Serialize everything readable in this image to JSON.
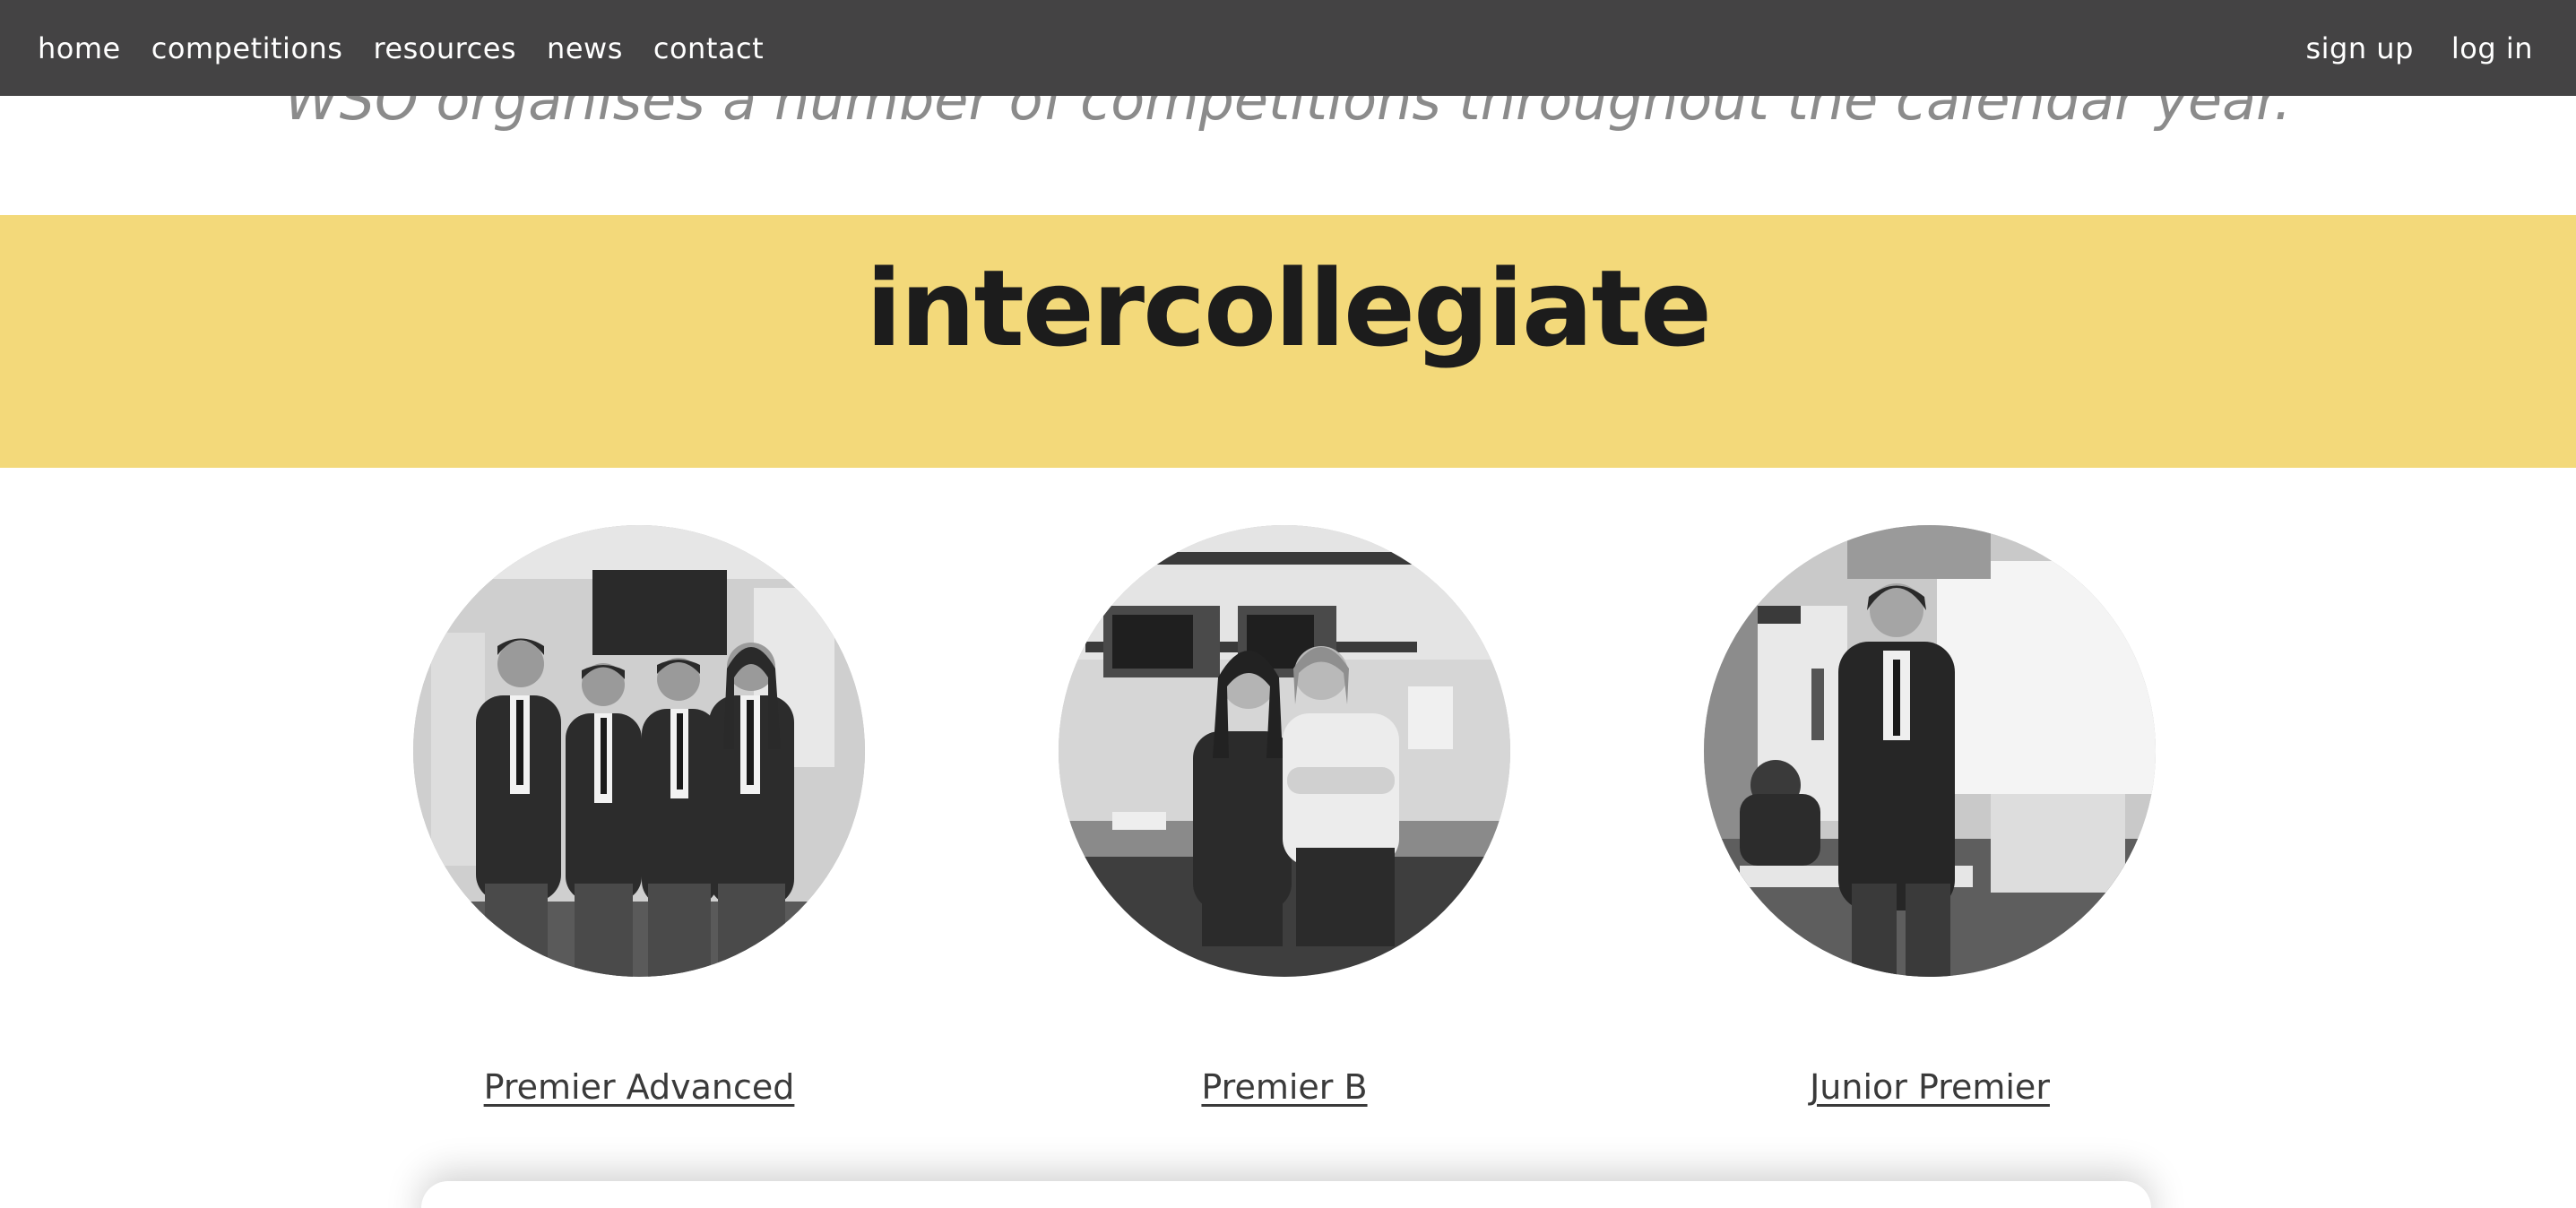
{
  "nav": {
    "left": [
      "home",
      "competitions",
      "resources",
      "news",
      "contact"
    ],
    "right": [
      "sign up",
      "log in"
    ]
  },
  "intro": {
    "text": "WSO organises a number of competitions throughout the calendar year."
  },
  "section": {
    "title": "intercollegiate"
  },
  "competitions": [
    {
      "label": "Premier Advanced",
      "photo": "group of four students in school blazers"
    },
    {
      "label": "Premier B",
      "photo": "two students smiling in a kitchen"
    },
    {
      "label": "Junior Premier",
      "photo": "student standing in a classroom"
    }
  ],
  "colors": {
    "navbar": "#444344",
    "banner": "#f3d97a",
    "title_text": "#1c1c1c",
    "intro_text": "#8b8b8b",
    "link_text": "#3a3a3a"
  }
}
